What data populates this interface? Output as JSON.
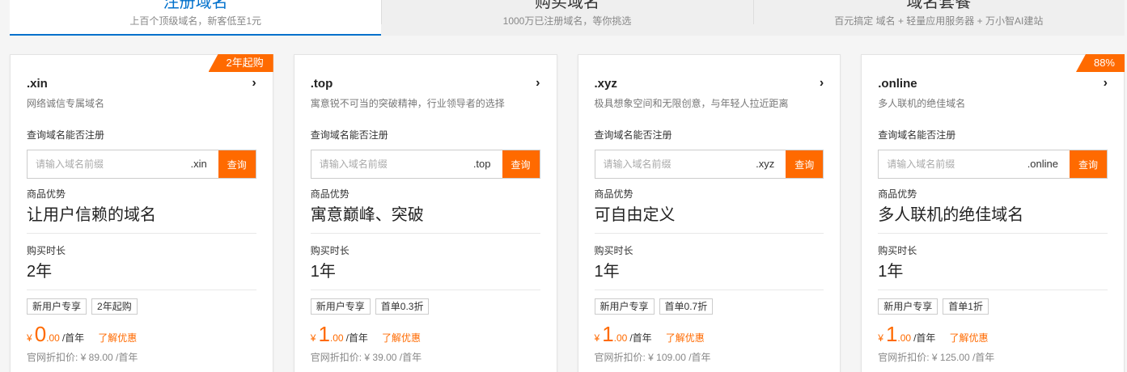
{
  "tabs": [
    {
      "title": "注册域名",
      "subtitle": "上百个顶级域名，新客低至1元",
      "active": true
    },
    {
      "title": "购买域名",
      "subtitle": "1000万已注册域名，等你挑选",
      "active": false
    },
    {
      "title": "域名套餐",
      "subtitle": "百元搞定 域名 + 轻量应用服务器 + 万小智AI建站",
      "active": false
    }
  ],
  "cards": [
    {
      "badge": "2年起购",
      "tld": ".xin",
      "desc": "网络诚信专属域名",
      "query_label": "查询域名能否注册",
      "placeholder": "请输入域名前缀",
      "suffix": ".xin",
      "query_button": "查询",
      "adv_label": "商品优势",
      "advantage": "让用户信赖的域名",
      "dur_label": "购买时长",
      "duration": "2年",
      "tags": [
        "新用户专享",
        "2年起购"
      ],
      "currency": "¥",
      "price_int": "0",
      "price_dec": ".00",
      "unit": "/首年",
      "learn": "了解优惠",
      "orig_price": "官网折扣价: ¥ 89.00 /首年"
    },
    {
      "badge": "",
      "tld": ".top",
      "desc": "寓意锐不可当的突破精神，行业领导者的选择",
      "query_label": "查询域名能否注册",
      "placeholder": "请输入域名前缀",
      "suffix": ".top",
      "query_button": "查询",
      "adv_label": "商品优势",
      "advantage": "寓意巅峰、突破",
      "dur_label": "购买时长",
      "duration": "1年",
      "tags": [
        "新用户专享",
        "首单0.3折"
      ],
      "currency": "¥",
      "price_int": "1",
      "price_dec": ".00",
      "unit": "/首年",
      "learn": "了解优惠",
      "orig_price": "官网折扣价: ¥ 39.00 /首年"
    },
    {
      "badge": "",
      "tld": ".xyz",
      "desc": "极具想象空间和无限创意，与年轻人拉近距离",
      "query_label": "查询域名能否注册",
      "placeholder": "请输入域名前缀",
      "suffix": ".xyz",
      "query_button": "查询",
      "adv_label": "商品优势",
      "advantage": "可自由定义",
      "dur_label": "购买时长",
      "duration": "1年",
      "tags": [
        "新用户专享",
        "首单0.7折"
      ],
      "currency": "¥",
      "price_int": "1",
      "price_dec": ".00",
      "unit": "/首年",
      "learn": "了解优惠",
      "orig_price": "官网折扣价: ¥ 109.00 /首年"
    },
    {
      "badge": "88%",
      "tld": ".online",
      "desc": "多人联机的绝佳域名",
      "query_label": "查询域名能否注册",
      "placeholder": "请输入域名前缀",
      "suffix": ".online",
      "query_button": "查询",
      "adv_label": "商品优势",
      "advantage": "多人联机的绝佳域名",
      "dur_label": "购买时长",
      "duration": "1年",
      "tags": [
        "新用户专享",
        "首单1折"
      ],
      "currency": "¥",
      "price_int": "1",
      "price_dec": ".00",
      "unit": "/首年",
      "learn": "了解优惠",
      "orig_price": "官网折扣价: ¥ 125.00 /首年"
    }
  ],
  "colors": {
    "accent": "#ff6a00",
    "active_tab": "#0070cc"
  },
  "icons": {
    "more": "chevron-right-icon"
  }
}
